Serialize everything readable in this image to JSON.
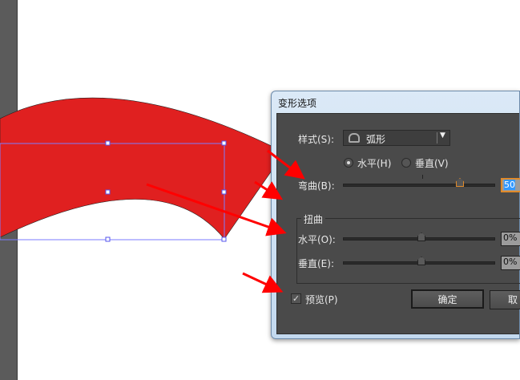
{
  "dialog": {
    "title": "变形选项",
    "style_label": "样式(S):",
    "style_value": "弧形",
    "orientation": {
      "horizontal": "水平(H)",
      "vertical": "垂直(V)",
      "selected": "horizontal"
    },
    "bend_label": "弯曲(B):",
    "bend_value": "50",
    "bend_percent": 50,
    "distortion_group": "扭曲",
    "dist_h_label": "水平(O):",
    "dist_h_value": "0%",
    "dist_v_label": "垂直(E):",
    "dist_v_value": "0%",
    "preview_label": "预览(P)",
    "preview_checked": true,
    "ok_label": "确定",
    "cancel_label": "取"
  },
  "colors": {
    "shape_fill": "#e02020",
    "selection": "#7b7bff",
    "arrow": "#ff0000"
  }
}
